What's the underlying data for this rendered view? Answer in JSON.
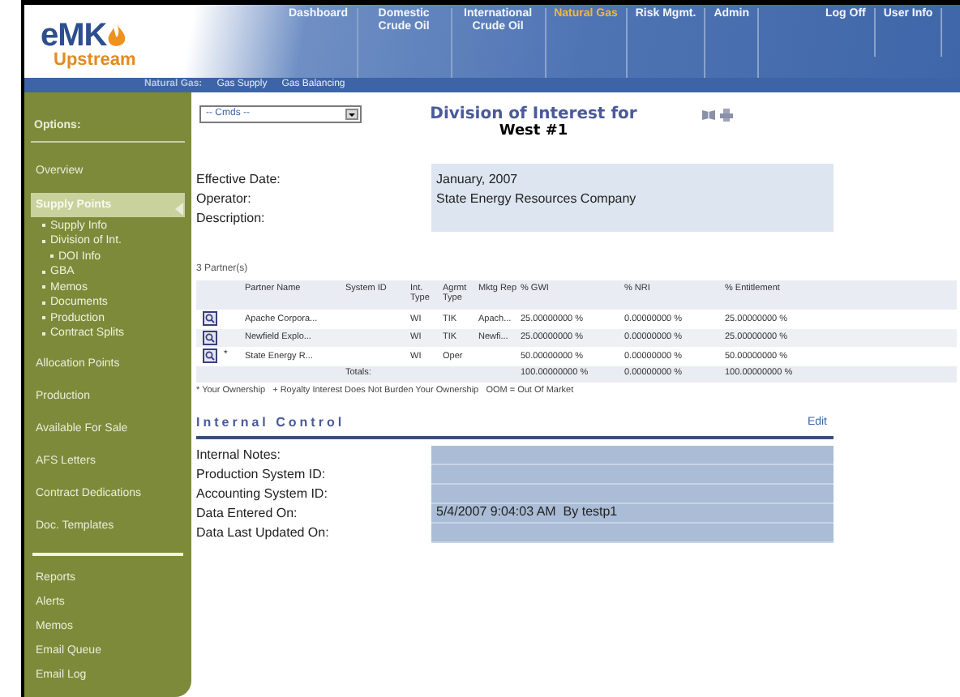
{
  "header": {
    "logo": {
      "mark": "eMK",
      "product": "Upstream"
    },
    "nav": [
      {
        "label": "Dashboard",
        "selected": false
      },
      {
        "label": "Domestic Crude Oil",
        "selected": false
      },
      {
        "label": "International Crude Oil",
        "selected": false
      },
      {
        "label": "Natural Gas",
        "selected": true
      },
      {
        "label": "Risk Mgmt.",
        "selected": false
      },
      {
        "label": "Admin",
        "selected": false
      }
    ],
    "account_links": [
      "Log Off",
      "User Info"
    ]
  },
  "subnav": {
    "label": "Natural Gas:",
    "items": [
      "Gas Supply",
      "Gas Balancing"
    ]
  },
  "sidebar": {
    "heading": "Options:",
    "items": [
      {
        "label": "Overview",
        "selected": false
      },
      {
        "label": "Supply Points",
        "selected": true,
        "children": [
          {
            "label": "Supply Info"
          },
          {
            "label": "Division of Int.",
            "children": [
              {
                "label": "DOI Info"
              }
            ]
          },
          {
            "label": "GBA"
          },
          {
            "label": "Memos"
          },
          {
            "label": "Documents"
          },
          {
            "label": "Production"
          },
          {
            "label": "Contract Splits"
          }
        ]
      },
      {
        "label": "Allocation Points",
        "selected": false
      },
      {
        "label": "Production",
        "selected": false
      },
      {
        "label": "Available For Sale",
        "selected": false
      },
      {
        "label": "AFS Letters",
        "selected": false
      },
      {
        "label": "Contract Dedications",
        "selected": false
      },
      {
        "label": "Doc. Templates",
        "selected": false
      }
    ],
    "bottom_items": [
      "Reports",
      "Alerts",
      "Memos",
      "Email Queue",
      "Email Log"
    ]
  },
  "commands": {
    "value": "-- Cmds --"
  },
  "title": {
    "line_1": "Division of Interest for",
    "line_2": "West #1"
  },
  "details": [
    {
      "label": "Effective Date:",
      "value": "January, 2007"
    },
    {
      "label": "Operator:",
      "value": "State Energy Resources Company"
    },
    {
      "label": "Description:"
    }
  ],
  "partners": {
    "count": "3 Partner(s)",
    "columns": [
      "Partner Name",
      "System ID",
      "Int. Type",
      "Agrmt Type",
      "Mktg Rep",
      "% GWI",
      "% NRI",
      "% Entitlement"
    ],
    "rows": [
      {
        "mark": "",
        "cells": [
          "Apache Corpora...",
          "",
          "WI",
          "TIK",
          "Apach...",
          "25.00000000 %",
          "0.00000000 %",
          "25.00000000 %"
        ]
      },
      {
        "mark": "",
        "cells": [
          "Newfield Explo...",
          "",
          "WI",
          "TIK",
          "Newfi...",
          "25.00000000 %",
          "0.00000000 %",
          "25.00000000 %"
        ]
      },
      {
        "mark": "*",
        "cells": [
          "State Energy R...",
          "",
          "WI",
          "Oper",
          "",
          "50.00000000 %",
          "0.00000000 %",
          "50.00000000 %"
        ]
      }
    ],
    "totals": {
      "label": "Totals:",
      "values": [
        "100.00000000 %",
        "0.00000000 %",
        "100.00000000 %"
      ]
    },
    "legend": "* Your Ownership   + Royalty Interest Does Not Burden Your Ownership   OOM = Out Of Market"
  },
  "internal_control": {
    "heading": "Internal Control",
    "edit": "Edit",
    "fields": [
      {
        "label": "Internal Notes:"
      },
      {
        "label": "Production System ID:"
      },
      {
        "label": "Accounting System ID:"
      },
      {
        "label": "Data Entered On:",
        "value": "5/4/2007 9:04:03 AM  By testp1"
      },
      {
        "label": "Data Last Updated On:"
      }
    ]
  }
}
